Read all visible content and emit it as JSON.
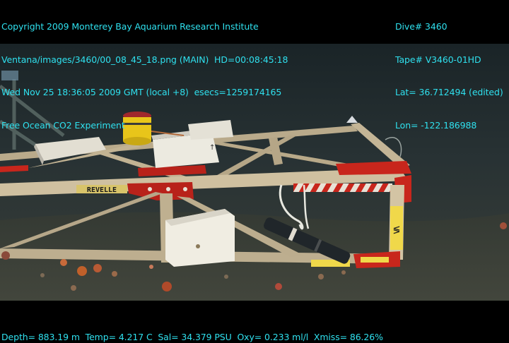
{
  "overlay": {
    "left_lines": [
      "Copyright 2009 Monterey Bay Aquarium Research Institute",
      "Ventana/images/3460/00_08_45_18.png (MAIN)  HD=00:08:45:18",
      "Wed Nov 25 18:36:05 2009 GMT (local +8)  esecs=1259174165",
      "Free Ocean CO2 Experiment"
    ],
    "right_lines": [
      "Dive# 3460",
      "Tape# V3460-01HD",
      "Lat= 36.712494 (edited)",
      "Lon= -122.186988"
    ],
    "bottom_line": "Depth= 883.19 m  Temp= 4.217 C  Sal= 34.379 PSU  Oxy= 0.233 ml/l  Xmiss= 86.26%"
  },
  "scene": {
    "frame_label": "REVELLE",
    "colors": {
      "overlay_text": "#2fe0ee",
      "water_top": "#1f2a2c",
      "seafloor": "#3b4039",
      "frame_beam": "#c9b99a",
      "red_stripe": "#c8261c",
      "box_white": "#e9e6dc",
      "buoy_yellow": "#e8c51a"
    }
  }
}
